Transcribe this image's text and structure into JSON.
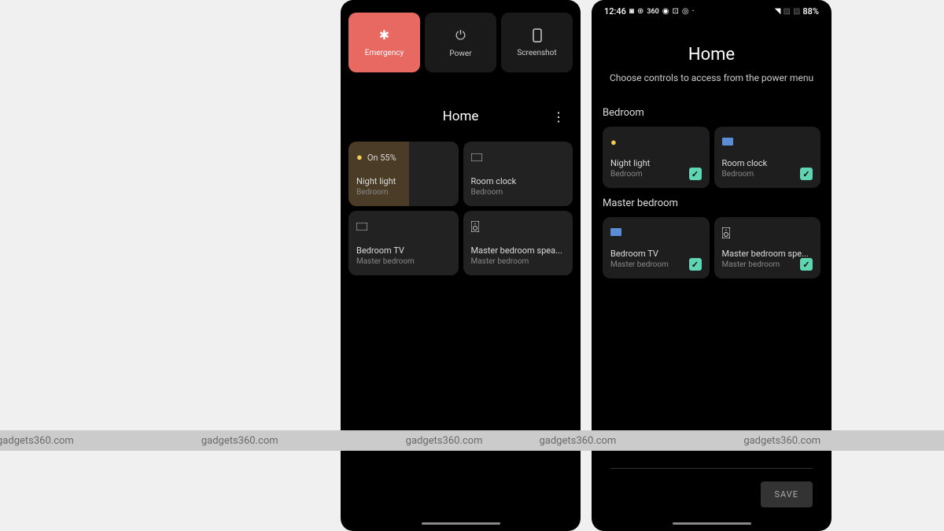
{
  "phone1": {
    "actions": {
      "emergency": "Emergency",
      "power": "Power",
      "screenshot": "Screenshot"
    },
    "section_title": "Home",
    "controls": [
      {
        "icon": "bulb",
        "status": "On 55%",
        "name": "Night light",
        "room": "Bedroom",
        "active": true
      },
      {
        "icon": "tv",
        "status": "",
        "name": "Room clock",
        "room": "Bedroom",
        "active": false
      },
      {
        "icon": "tv",
        "status": "",
        "name": "Bedroom TV",
        "room": "Master bedroom",
        "active": false
      },
      {
        "icon": "speaker",
        "status": "",
        "name": "Master bedroom spea...",
        "room": "Master bedroom",
        "active": false
      }
    ]
  },
  "phone2": {
    "status": {
      "time": "12:46",
      "battery": "88%"
    },
    "title": "Home",
    "subtitle": "Choose controls to access from the power menu",
    "sections": [
      {
        "label": "Bedroom",
        "items": [
          {
            "icon": "bulb",
            "name": "Night light",
            "room": "Bedroom",
            "checked": true
          },
          {
            "icon": "clock",
            "name": "Room clock",
            "room": "Bedroom",
            "checked": true
          }
        ]
      },
      {
        "label": "Master bedroom",
        "items": [
          {
            "icon": "tv",
            "name": "Bedroom TV",
            "room": "Master bedroom",
            "checked": true
          },
          {
            "icon": "speaker",
            "name": "Master bedroom spe...",
            "room": "Master bedroom",
            "checked": true
          }
        ]
      }
    ],
    "save_label": "SAVE"
  },
  "watermark": "gadgets360.com"
}
